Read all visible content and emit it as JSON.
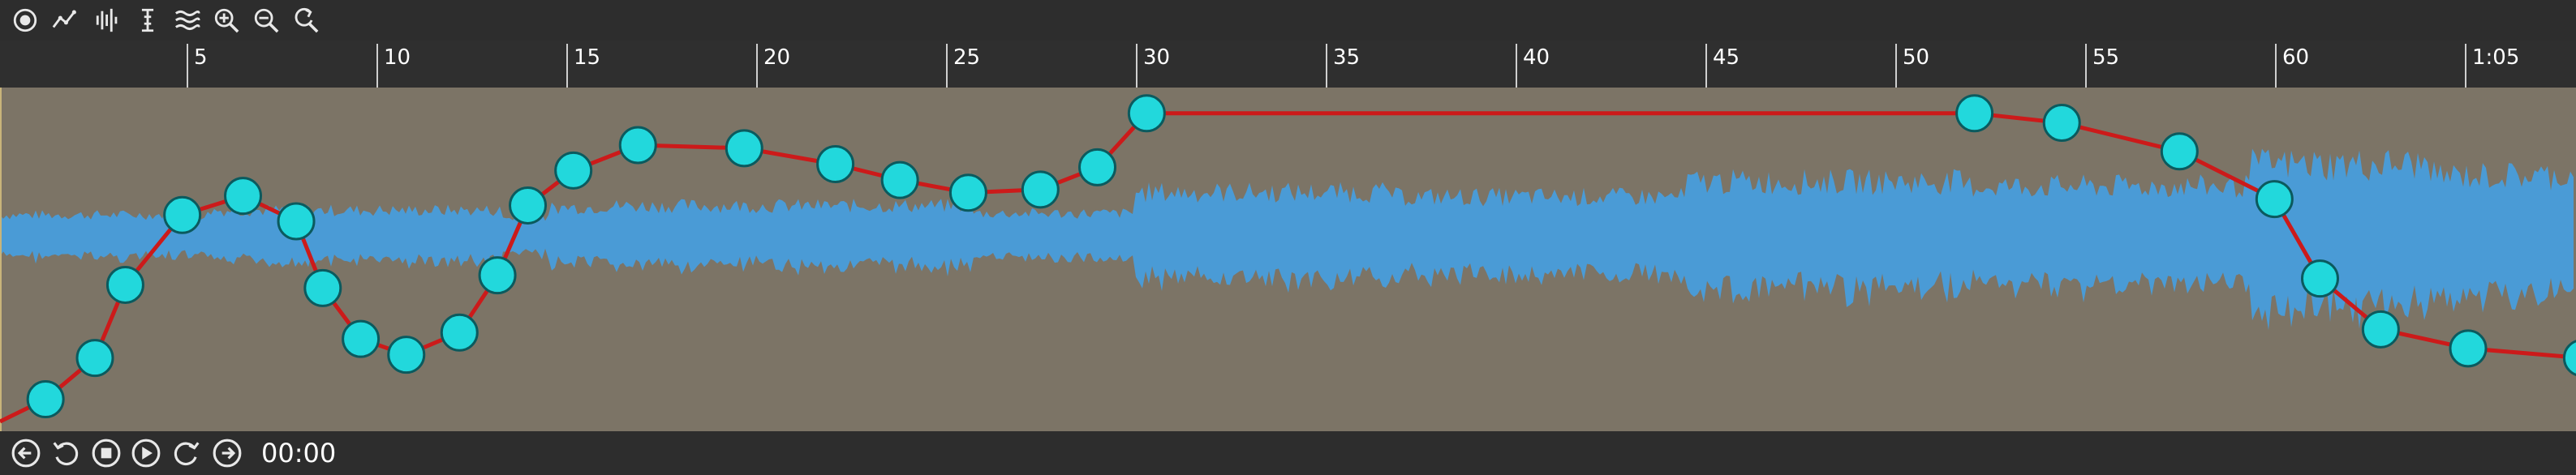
{
  "toolbar": {
    "tools": [
      {
        "name": "select-tool-icon"
      },
      {
        "name": "envelope-tool-icon"
      },
      {
        "name": "multi-tool-icon"
      },
      {
        "name": "text-cursor-tool-icon"
      },
      {
        "name": "waveform-view-icon"
      },
      {
        "name": "zoom-in-icon"
      },
      {
        "name": "zoom-out-icon"
      },
      {
        "name": "zoom-reset-icon"
      }
    ]
  },
  "ruler": {
    "labels": [
      "5",
      "10",
      "15",
      "20",
      "25",
      "30",
      "35",
      "40",
      "45",
      "50",
      "55",
      "60",
      "1:05"
    ]
  },
  "transport": {
    "buttons": [
      {
        "name": "skip-to-start-icon"
      },
      {
        "name": "rewind-icon"
      },
      {
        "name": "stop-icon"
      },
      {
        "name": "play-icon"
      },
      {
        "name": "fast-forward-icon"
      },
      {
        "name": "skip-to-end-icon"
      }
    ],
    "time": "00:00"
  },
  "colors": {
    "background": "#7c7466",
    "waveform": "#4a9bd6",
    "envelope_line": "#cc1a1a",
    "envelope_point": "#22d8dc",
    "envelope_point_border": "#0b5a5e",
    "toolbar": "#2d2d2d",
    "ruler": "#2f2f2f",
    "text": "#ffffff"
  },
  "envelope": {
    "duration_seconds": 68,
    "points": [
      {
        "t": 0.0,
        "v": 0.0
      },
      {
        "t": 1.2,
        "v": 0.07
      },
      {
        "t": 2.5,
        "v": 0.2
      },
      {
        "t": 3.3,
        "v": 0.43
      },
      {
        "t": 4.8,
        "v": 0.65
      },
      {
        "t": 6.4,
        "v": 0.71
      },
      {
        "t": 7.8,
        "v": 0.63
      },
      {
        "t": 8.5,
        "v": 0.42
      },
      {
        "t": 9.5,
        "v": 0.26
      },
      {
        "t": 10.7,
        "v": 0.21
      },
      {
        "t": 12.1,
        "v": 0.28
      },
      {
        "t": 13.1,
        "v": 0.46
      },
      {
        "t": 13.9,
        "v": 0.68
      },
      {
        "t": 15.1,
        "v": 0.79
      },
      {
        "t": 16.8,
        "v": 0.87
      },
      {
        "t": 19.6,
        "v": 0.86
      },
      {
        "t": 22.0,
        "v": 0.81
      },
      {
        "t": 23.7,
        "v": 0.76
      },
      {
        "t": 25.5,
        "v": 0.72
      },
      {
        "t": 27.4,
        "v": 0.73
      },
      {
        "t": 28.9,
        "v": 0.8
      },
      {
        "t": 30.2,
        "v": 0.97
      },
      {
        "t": 52.0,
        "v": 0.97
      },
      {
        "t": 54.3,
        "v": 0.94
      },
      {
        "t": 57.4,
        "v": 0.85
      },
      {
        "t": 59.9,
        "v": 0.7
      },
      {
        "t": 61.1,
        "v": 0.45
      },
      {
        "t": 62.7,
        "v": 0.29
      },
      {
        "t": 65.0,
        "v": 0.23
      },
      {
        "t": 68.0,
        "v": 0.2
      }
    ]
  }
}
